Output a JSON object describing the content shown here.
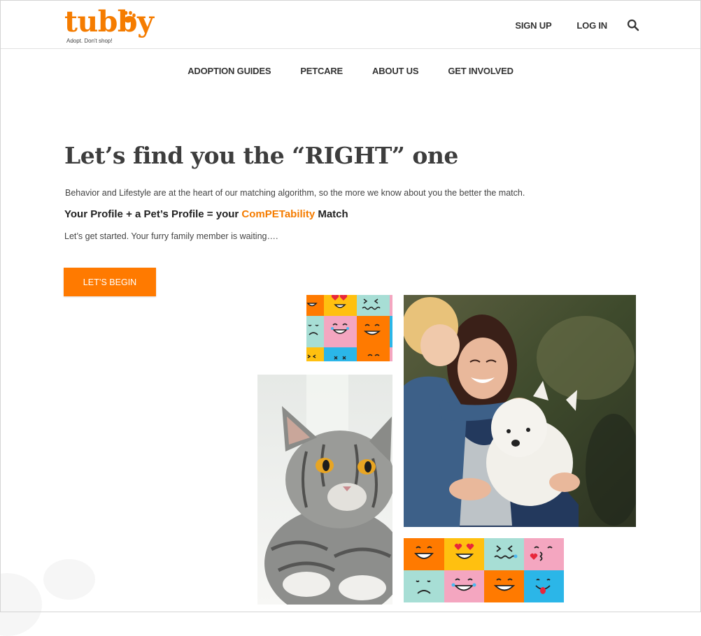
{
  "brand": {
    "name": "tubby",
    "tagline": "Adopt. Don't shop!",
    "accent": "#f57c00"
  },
  "header": {
    "signup_label": "SIGN UP",
    "login_label": "LOG IN",
    "search_icon": "search-icon"
  },
  "nav": {
    "items": [
      "ADOPTION GUIDES",
      "PETCARE",
      "ABOUT US",
      "GET INVOLVED"
    ]
  },
  "hero": {
    "title": "Let’s find you the “RIGHT” one",
    "intro": "Behavior and Lifestyle are at the heart of our matching algorithm, so the more we know about you the better the match.",
    "formula_prefix": "Your Profile + a Pet’s Profile = your",
    "formula_brand": "ComPETability",
    "formula_suffix": "Match",
    "started": "Let’s get started. Your furry family member is waiting….",
    "cta_label": "LET’S BEGIN",
    "cta_color": "#ff7a00"
  },
  "images": {
    "emoji_top": "emoji-grid-photo",
    "cat": "cat-photo",
    "family": "woman-child-dog-photo",
    "emoji_bottom": "emoji-grid-photo"
  }
}
